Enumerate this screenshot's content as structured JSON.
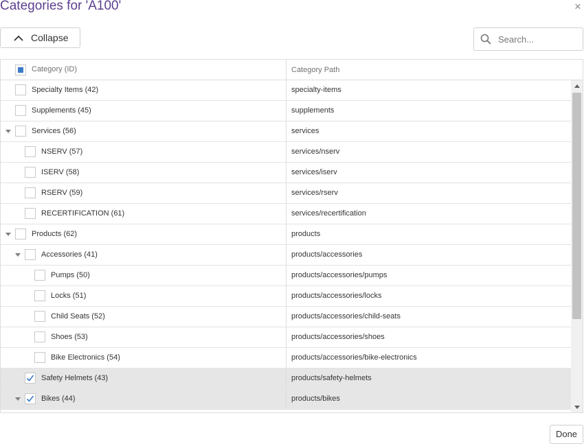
{
  "dialog": {
    "title": "Categories for 'A100'",
    "close_glyph": "×"
  },
  "toolbar": {
    "collapse_label": "Collapse",
    "search_placeholder": "Search..."
  },
  "grid": {
    "columns": [
      "Category (ID)",
      "Category Path"
    ],
    "rows": [
      {
        "label": "Specialty Items (42)",
        "path": "specialty-items",
        "level": 0,
        "expander": "none",
        "checked": false
      },
      {
        "label": "Supplements (45)",
        "path": "supplements",
        "level": 0,
        "expander": "none",
        "checked": false
      },
      {
        "label": "Services (56)",
        "path": "services",
        "level": 0,
        "expander": "expanded",
        "checked": false
      },
      {
        "label": "NSERV (57)",
        "path": "services/nserv",
        "level": 1,
        "expander": "none",
        "checked": false
      },
      {
        "label": "ISERV (58)",
        "path": "services/iserv",
        "level": 1,
        "expander": "none",
        "checked": false
      },
      {
        "label": "RSERV (59)",
        "path": "services/rserv",
        "level": 1,
        "expander": "none",
        "checked": false
      },
      {
        "label": "RECERTIFICATION (61)",
        "path": "services/recertification",
        "level": 1,
        "expander": "none",
        "checked": false
      },
      {
        "label": "Products (62)",
        "path": "products",
        "level": 0,
        "expander": "expanded",
        "checked": false
      },
      {
        "label": "Accessories (41)",
        "path": "products/accessories",
        "level": 1,
        "expander": "expanded",
        "checked": false
      },
      {
        "label": "Pumps (50)",
        "path": "products/accessories/pumps",
        "level": 2,
        "expander": "none",
        "checked": false
      },
      {
        "label": "Locks (51)",
        "path": "products/accessories/locks",
        "level": 2,
        "expander": "none",
        "checked": false
      },
      {
        "label": "Child Seats (52)",
        "path": "products/accessories/child-seats",
        "level": 2,
        "expander": "none",
        "checked": false
      },
      {
        "label": "Shoes (53)",
        "path": "products/accessories/shoes",
        "level": 2,
        "expander": "none",
        "checked": false
      },
      {
        "label": "Bike Electronics (54)",
        "path": "products/accessories/bike-electronics",
        "level": 2,
        "expander": "none",
        "checked": false
      },
      {
        "label": "Safety Helmets (43)",
        "path": "products/safety-helmets",
        "level": 1,
        "expander": "none",
        "checked": true
      },
      {
        "label": "Bikes (44)",
        "path": "products/bikes",
        "level": 1,
        "expander": "expanded",
        "checked": true
      }
    ]
  },
  "footer": {
    "done_label": "Done"
  },
  "icons": {
    "collapse": "chevron-up-icon",
    "search": "search-icon",
    "close": "close-icon",
    "expander": "caret-down-icon",
    "check": "checkmark-icon"
  },
  "colors": {
    "title": "#5b3f8f",
    "check": "#3a7ac8",
    "selected_row": "#e6e6e6"
  }
}
